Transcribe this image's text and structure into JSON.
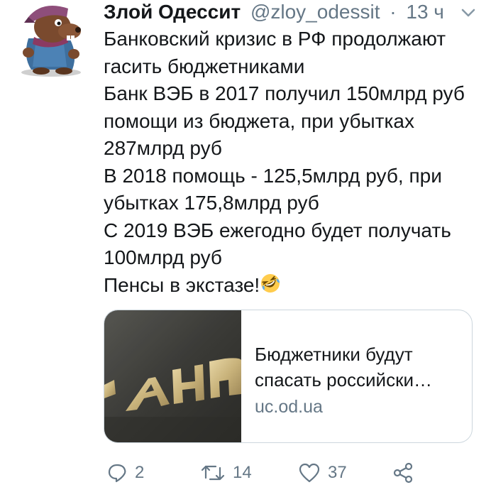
{
  "tweet": {
    "display_name": "Злой Одессит",
    "handle": "@zloy_odessit",
    "separator": "·",
    "time": "13 ч",
    "text_lines": [
      "Банковский кризис в РФ продолжают",
      "гасить бюджетниками",
      "Банк ВЭБ в 2017 получил 150млрд руб",
      "помощи из бюджета, при убытках",
      "287млрд руб",
      "В 2018 помощь - 125,5млрд руб, при",
      "убытках 175,8млрд руб",
      "С 2019 ВЭБ ежегодно будет получать",
      "100млрд руб",
      "Пенсы в экстазе!"
    ],
    "emoji": "rolling-on-floor-laughing"
  },
  "card": {
    "title_line1": "Бюджетники будут",
    "title_line2": "спасать российски…",
    "domain": "uc.od.ua"
  },
  "actions": {
    "reply_count": "2",
    "retweet_count": "14",
    "like_count": "37"
  },
  "colors": {
    "text": "#14171a",
    "secondary": "#657786",
    "border": "#ccd6dd"
  }
}
